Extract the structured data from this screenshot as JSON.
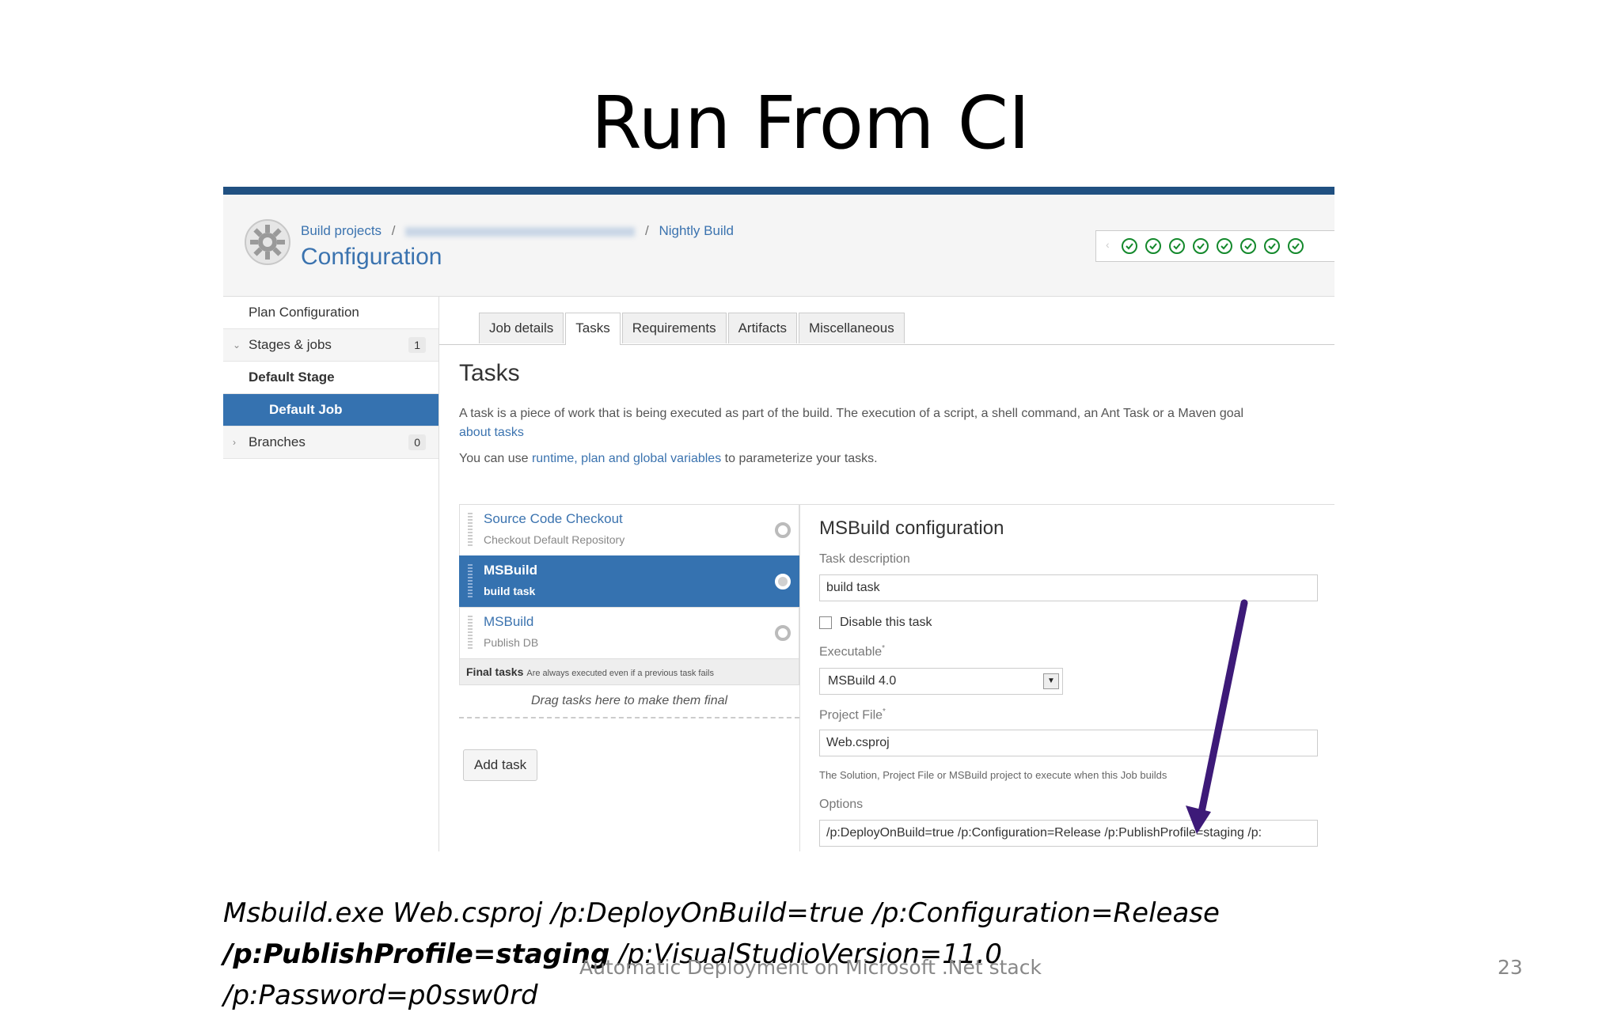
{
  "slide": {
    "title": "Run From CI",
    "footer": "Automatic Deployment on Microsoft .Net stack",
    "page_number": "23"
  },
  "command": {
    "line1": "Msbuild.exe Web.csproj /p:DeployOnBuild=true /p:Configuration=Release",
    "line2_bold": "/p:PublishProfile=staging",
    "line2_rest": " /p:VisualStudioVersion=11.0",
    "line3": "/p:Password=p0ssw0rd"
  },
  "header": {
    "breadcrumb_root": "Build projects",
    "breadcrumb_sep": "/",
    "breadcrumb_current": "Nightly Build",
    "title": "Configuration",
    "build_status_count": 8,
    "status_color": "#14892c"
  },
  "sidebar": {
    "items": [
      {
        "label": "Plan Configuration"
      },
      {
        "label": "Stages & jobs",
        "count": "1"
      },
      {
        "label": "Default Stage"
      },
      {
        "label": "Default Job"
      },
      {
        "label": "Branches",
        "count": "0"
      }
    ]
  },
  "tabs": [
    "Job details",
    "Tasks",
    "Requirements",
    "Artifacts",
    "Miscellaneous"
  ],
  "active_tab": "Tasks",
  "tasks_section": {
    "heading": "Tasks",
    "desc_text": "A task is a piece of work that is being executed as part of the build. The execution of a script, a shell command, an Ant Task or a Maven goal",
    "desc_link": "about tasks",
    "vars_prefix": "You can use ",
    "vars_link": "runtime, plan and global variables",
    "vars_suffix": " to parameterize your tasks."
  },
  "task_list": [
    {
      "name": "Source Code Checkout",
      "desc": "Checkout Default Repository"
    },
    {
      "name": "MSBuild",
      "desc": "build task",
      "selected": true
    },
    {
      "name": "MSBuild",
      "desc": "Publish DB"
    }
  ],
  "final_tasks": {
    "label": "Final tasks",
    "note": "Are always executed even if a previous task fails",
    "drop_hint": "Drag tasks here to make them final"
  },
  "add_task_label": "Add task",
  "config": {
    "title": "MSBuild configuration",
    "task_description_label": "Task description",
    "task_description_value": "build task",
    "disable_label": "Disable this task",
    "executable_label": "Executable",
    "executable_value": "MSBuild 4.0",
    "project_file_label": "Project File",
    "project_file_value": "Web.csproj",
    "project_file_help": "The Solution, Project File or MSBuild project to execute when this Job builds",
    "options_label": "Options",
    "options_value": "/p:DeployOnBuild=true /p:Configuration=Release /p:PublishProfile=staging /p:",
    "required_mark": "*",
    "accent_color": "#3572b0",
    "arrow_color": "#3d1a78"
  }
}
